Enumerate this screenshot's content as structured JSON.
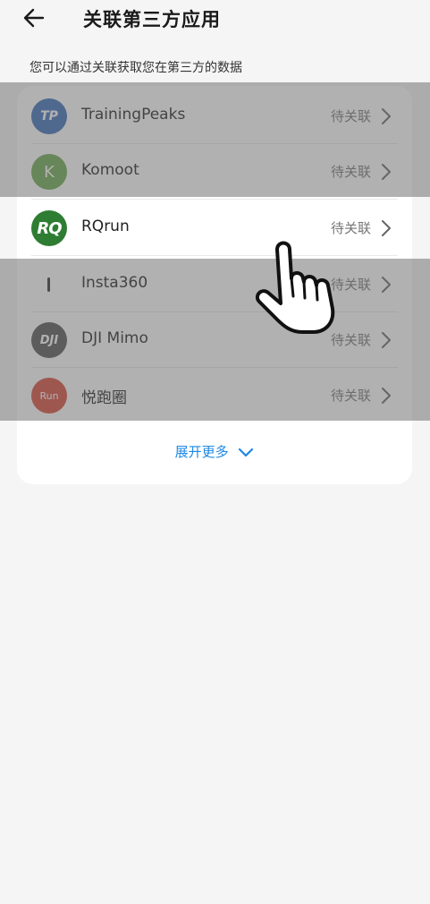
{
  "header": {
    "title": "关联第三方应用",
    "back_icon": "arrow-left-icon"
  },
  "subtitle": "您可以通过关联获取您在第三方的数据",
  "apps": [
    {
      "name": "TrainingPeaks",
      "logo_text": "TP",
      "status": "待关联"
    },
    {
      "name": "Komoot",
      "logo_text": "K",
      "status": "待关联"
    },
    {
      "name": "RQrun",
      "logo_text": "RQ",
      "status": "待关联"
    },
    {
      "name": "Insta360",
      "logo_text": "",
      "status": "待关联"
    },
    {
      "name": "DJI Mimo",
      "logo_text": "DJI",
      "status": "待关联"
    },
    {
      "name": "悦跑圈",
      "logo_text": "Run",
      "status": "待关联"
    }
  ],
  "expand_more": "展开更多",
  "colors": {
    "accent": "#1e88e5",
    "rqrun_logo": "#2e7d32",
    "background": "#f5f5f5"
  },
  "overlay": {
    "pointer": "hand-pointer-icon"
  }
}
